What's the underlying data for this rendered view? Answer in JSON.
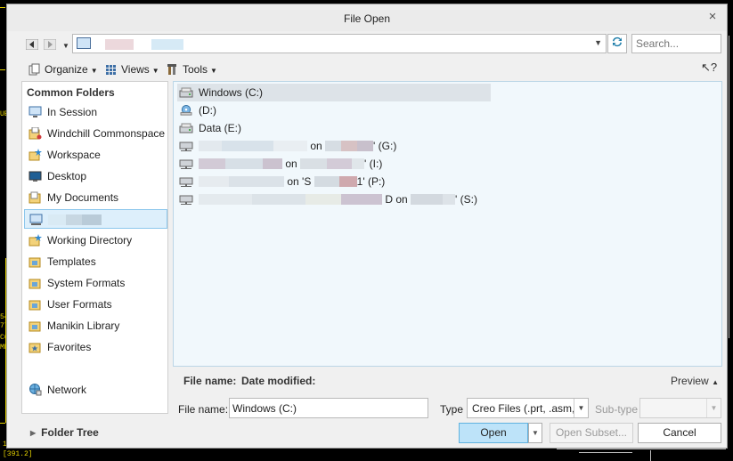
{
  "window": {
    "title": "File Open",
    "close_glyph": "×"
  },
  "address_bar": {
    "path_hidden": true
  },
  "search": {
    "placeholder": "Search..."
  },
  "toolbar": {
    "organize": "Organize",
    "views": "Views",
    "tools": "Tools"
  },
  "sidebar": {
    "header": "Common Folders",
    "items": [
      {
        "label": "In Session",
        "icon": "monitor-icon"
      },
      {
        "label": "Windchill Commonspace",
        "icon": "commonspace-icon"
      },
      {
        "label": "Workspace",
        "icon": "workspace-icon"
      },
      {
        "label": "Desktop",
        "icon": "desktop-icon"
      },
      {
        "label": "My Documents",
        "icon": "documents-icon"
      },
      {
        "label": "",
        "icon": "computer-icon",
        "selected": true
      },
      {
        "label": "Working Directory",
        "icon": "working-directory-icon"
      },
      {
        "label": "Templates",
        "icon": "folder-icon"
      },
      {
        "label": "System Formats",
        "icon": "folder-icon"
      },
      {
        "label": "User Formats",
        "icon": "folder-icon"
      },
      {
        "label": "Manikin Library",
        "icon": "folder-icon"
      },
      {
        "label": "Favorites",
        "icon": "favorites-icon"
      },
      {
        "label": "Network",
        "icon": "network-icon"
      }
    ]
  },
  "files": [
    {
      "name": "Windows (C:)",
      "icon": "drive-icon",
      "selected": true
    },
    {
      "name": "(D:)",
      "icon": "disc-drive-icon"
    },
    {
      "name": "Data (E:)",
      "icon": "drive-icon"
    },
    {
      "name_suffix": "' (G:)",
      "name_on": "on",
      "icon": "network-drive-icon"
    },
    {
      "name_suffix": "' (I:)",
      "name_on": "on",
      "icon": "network-drive-icon"
    },
    {
      "name_suffix": "1' (P:)",
      "name_on": "on 'S",
      "icon": "network-drive-icon"
    },
    {
      "name_suffix": "' (S:)",
      "name_on": "D on",
      "icon": "network-drive-icon"
    }
  ],
  "info": {
    "file_name_label": "File name:",
    "date_modified_label": "Date modified:",
    "preview_label": "Preview"
  },
  "form": {
    "file_name_label": "File name:",
    "file_name_value": "Windows (C:)",
    "type_label": "Type",
    "type_value": "Creo Files (.prt, .asm, .",
    "subtype_label": "Sub-type"
  },
  "footer": {
    "folder_tree": "Folder Tree",
    "open": "Open",
    "open_subset": "Open Subset...",
    "cancel": "Cancel"
  },
  "colors": {
    "selection": "#ddeffb",
    "selection_border": "#8cc7ec",
    "list_background": "#f1f8fc",
    "open_button": "#bde3f9",
    "cad_yellow": "#e6d200"
  },
  "cad_background": {
    "labels": [
      "UE",
      "54",
      "77.",
      "C6",
      "MRP",
      "15",
      "[391.2]"
    ]
  }
}
